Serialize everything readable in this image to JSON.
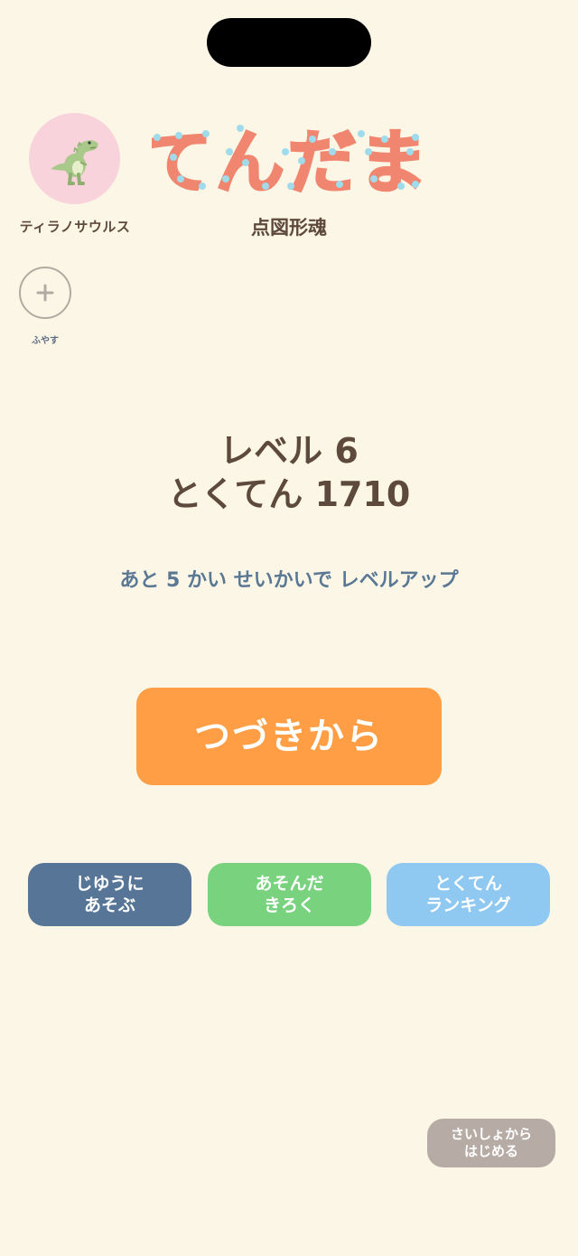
{
  "profile": {
    "name": "ティラノサウルス",
    "avatar_icon": "t-rex-icon",
    "avatar_bg": "#f8d3dc"
  },
  "add_profile": {
    "label": "ふやす",
    "icon": "plus-icon"
  },
  "logo": {
    "title": "てんだま",
    "subtitle": "点図形魂",
    "color": "#f08670",
    "dot_color": "#9fdbea"
  },
  "status": {
    "level_text": "レベル 6",
    "score_text": "とくてん 1710",
    "progress_text": "あと 5 かい せいかいで レベルアップ"
  },
  "buttons": {
    "continue": "つづきから",
    "free_play": [
      "じゆうに",
      "あそぶ"
    ],
    "play_record": [
      "あそんだ",
      "きろく"
    ],
    "score_ranking": [
      "とくてん",
      "ランキング"
    ],
    "restart": [
      "さいしょから",
      "はじめる"
    ]
  },
  "colors": {
    "background": "#fcf6e6",
    "continue": "#ff9e44",
    "free_play": "#577596",
    "play_record": "#79d27e",
    "score_ranking": "#8fc8f0",
    "restart": "#b7aca5",
    "text": "#5e4a3c",
    "progress": "#5a7894"
  }
}
